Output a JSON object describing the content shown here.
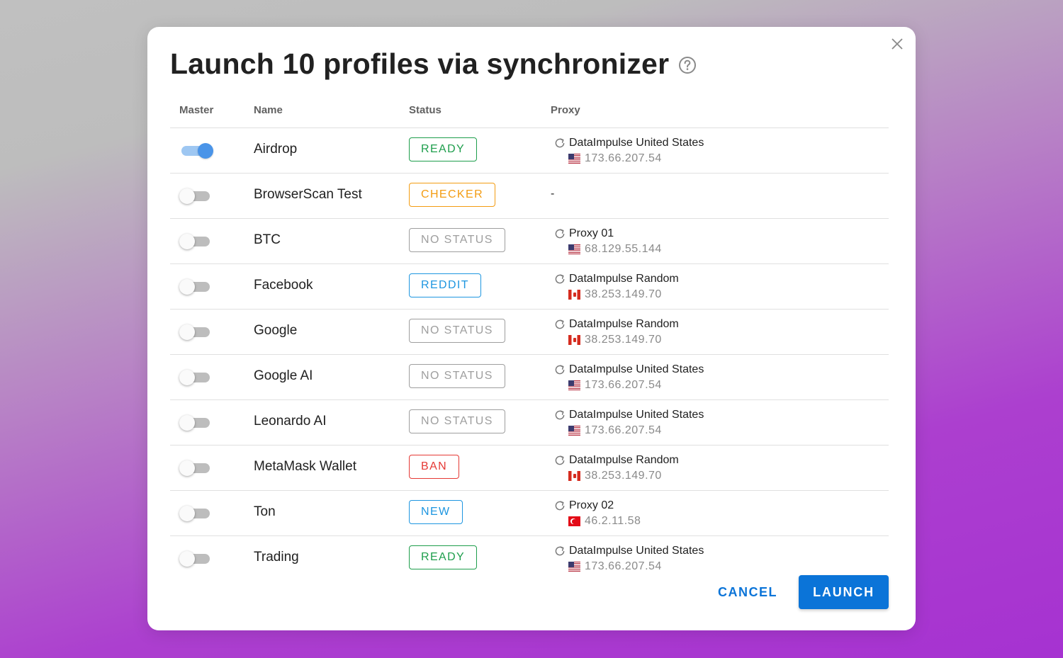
{
  "dialog": {
    "title": "Launch 10 profiles via synchronizer",
    "help_icon": "question-circle-icon",
    "close_icon": "close-icon"
  },
  "table": {
    "headers": {
      "master": "Master",
      "name": "Name",
      "status": "Status",
      "proxy": "Proxy"
    },
    "rows": [
      {
        "master": true,
        "name": "Airdrop",
        "status": "READY",
        "status_color": "#1e9e4c",
        "proxy_name": "DataImpulse United States",
        "proxy_ip": "173.66.207.54",
        "flag": "us"
      },
      {
        "master": false,
        "name": "BrowserScan Test",
        "status": "CHECKER",
        "status_color": "#f39c12",
        "proxy_name": "-",
        "proxy_ip": "",
        "flag": ""
      },
      {
        "master": false,
        "name": "BTC",
        "status": "NO STATUS",
        "status_color": "#9e9e9e",
        "proxy_name": "Proxy 01",
        "proxy_ip": "68.129.55.144",
        "flag": "us"
      },
      {
        "master": false,
        "name": "Facebook",
        "status": "REDDIT",
        "status_color": "#1e96e0",
        "proxy_name": "DataImpulse Random",
        "proxy_ip": "38.253.149.70",
        "flag": "ca"
      },
      {
        "master": false,
        "name": "Google",
        "status": "NO STATUS",
        "status_color": "#9e9e9e",
        "proxy_name": "DataImpulse Random",
        "proxy_ip": "38.253.149.70",
        "flag": "ca"
      },
      {
        "master": false,
        "name": "Google AI",
        "status": "NO STATUS",
        "status_color": "#9e9e9e",
        "proxy_name": "DataImpulse United States",
        "proxy_ip": "173.66.207.54",
        "flag": "us"
      },
      {
        "master": false,
        "name": "Leonardo AI",
        "status": "NO STATUS",
        "status_color": "#9e9e9e",
        "proxy_name": "DataImpulse United States",
        "proxy_ip": "173.66.207.54",
        "flag": "us"
      },
      {
        "master": false,
        "name": "MetaMask Wallet",
        "status": "BAN",
        "status_color": "#e53935",
        "proxy_name": "DataImpulse Random",
        "proxy_ip": "38.253.149.70",
        "flag": "ca"
      },
      {
        "master": false,
        "name": "Ton",
        "status": "NEW",
        "status_color": "#1e96e0",
        "proxy_name": "Proxy 02",
        "proxy_ip": "46.2.11.58",
        "flag": "tr"
      },
      {
        "master": false,
        "name": "Trading",
        "status": "READY",
        "status_color": "#1e9e4c",
        "proxy_name": "DataImpulse United States",
        "proxy_ip": "173.66.207.54",
        "flag": "us"
      }
    ]
  },
  "footer": {
    "cancel_label": "CANCEL",
    "launch_label": "LAUNCH"
  },
  "colors": {
    "accent": "#0b74d8",
    "cancel_text": "#0b74d8",
    "toggle_on_thumb": "#4a94e8",
    "toggle_on_track": "#9ec7f2"
  }
}
